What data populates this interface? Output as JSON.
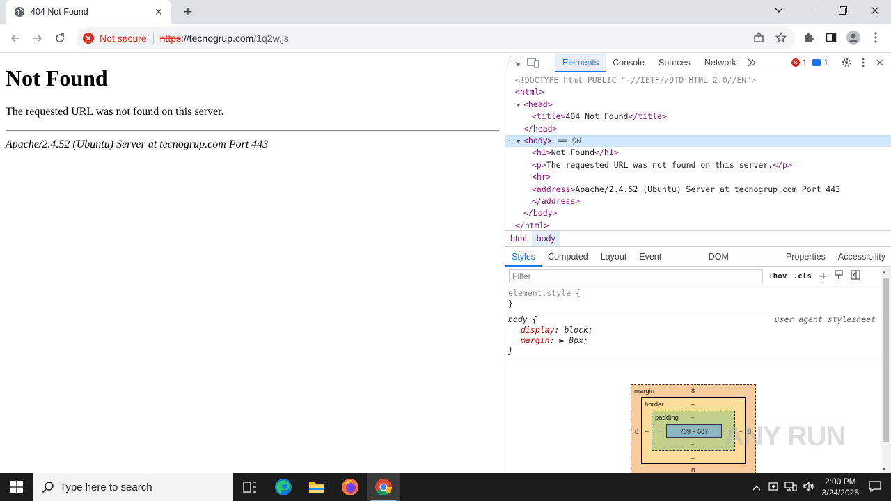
{
  "browser": {
    "tab_title": "404 Not Found",
    "security_label": "Not secure",
    "url_scheme": "https",
    "url_host": "://tecnogrup.com",
    "url_path": "/1q2w.js"
  },
  "page": {
    "heading": "Not Found",
    "message": "The requested URL was not found on this server.",
    "address": "Apache/2.4.52 (Ubuntu) Server at tecnogrup.com Port 443"
  },
  "devtools": {
    "tabs": [
      "Elements",
      "Console",
      "Sources",
      "Network"
    ],
    "error_count": "1",
    "message_count": "1",
    "dom": {
      "doctype": "<!DOCTYPE html PUBLIC \"-//IETF//DTD HTML 2.0//EN\">",
      "html_open": "<html>",
      "head_open": "<head>",
      "title_open": "<title>",
      "title_text": "404 Not Found",
      "title_close": "</title>",
      "head_close": "</head>",
      "body_open": "<body>",
      "body_marker": " == $0",
      "h1_open": "<h1>",
      "h1_text": "Not Found",
      "h1_close": "</h1>",
      "p_open": "<p>",
      "p_text": "The requested URL was not found on this server.",
      "p_close": "</p>",
      "hr": "<hr>",
      "address_open": "<address>",
      "address_text": "Apache/2.4.52 (Ubuntu) Server at tecnogrup.com Port 443",
      "address_close": "</address>",
      "body_close": "</body>",
      "html_close": "</html>"
    },
    "breadcrumbs": [
      "html",
      "body"
    ],
    "subtabs": [
      "Styles",
      "Computed",
      "Layout",
      "Event Listeners",
      "DOM Breakpoints",
      "Properties",
      "Accessibility"
    ],
    "filter_placeholder": "Filter",
    "hov_label": ":hov",
    "cls_label": ".cls",
    "styles": {
      "element_style_selector": "element.style {",
      "close_brace": "}",
      "body_selector": "body {",
      "ua_label": "user agent stylesheet",
      "display_prop": "display",
      "display_value": ": block;",
      "margin_prop": "margin",
      "margin_value": ": ▶ 8px;"
    },
    "box_model": {
      "margin_label": "margin",
      "margin_value": "8",
      "border_label": "border",
      "border_value": "–",
      "padding_label": "padding",
      "padding_value": "–",
      "content_size": "709 × 587",
      "dash": "–"
    }
  },
  "taskbar": {
    "search_placeholder": "Type here to search",
    "time": "2:00 PM",
    "date": "3/24/2025"
  },
  "watermark": "ANY RUN"
}
